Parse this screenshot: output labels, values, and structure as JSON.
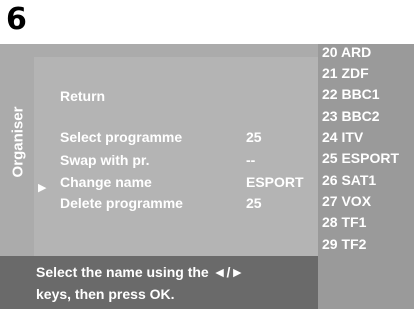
{
  "step": "6",
  "sidebar": {
    "label": "Organiser"
  },
  "menu": {
    "items": [
      {
        "label": "Return",
        "value": ""
      },
      {
        "label": "Select programme",
        "value": "25"
      },
      {
        "label": "Swap with pr.",
        "value": "--"
      },
      {
        "label": "Change name",
        "value": "ESPORT"
      },
      {
        "label": "Delete programme",
        "value": "25"
      }
    ],
    "pointer_glyph": "▶"
  },
  "channels": [
    "20 ARD",
    "21 ZDF",
    "22 BBC1",
    "23 BBC2",
    "24 ITV",
    "25 ESPORT",
    "26 SAT1",
    "27 VOX",
    "28 TF1",
    "29 TF2"
  ],
  "hint": {
    "line1": "Select the name using the ◄/► ",
    "line2": "keys, then press OK."
  }
}
